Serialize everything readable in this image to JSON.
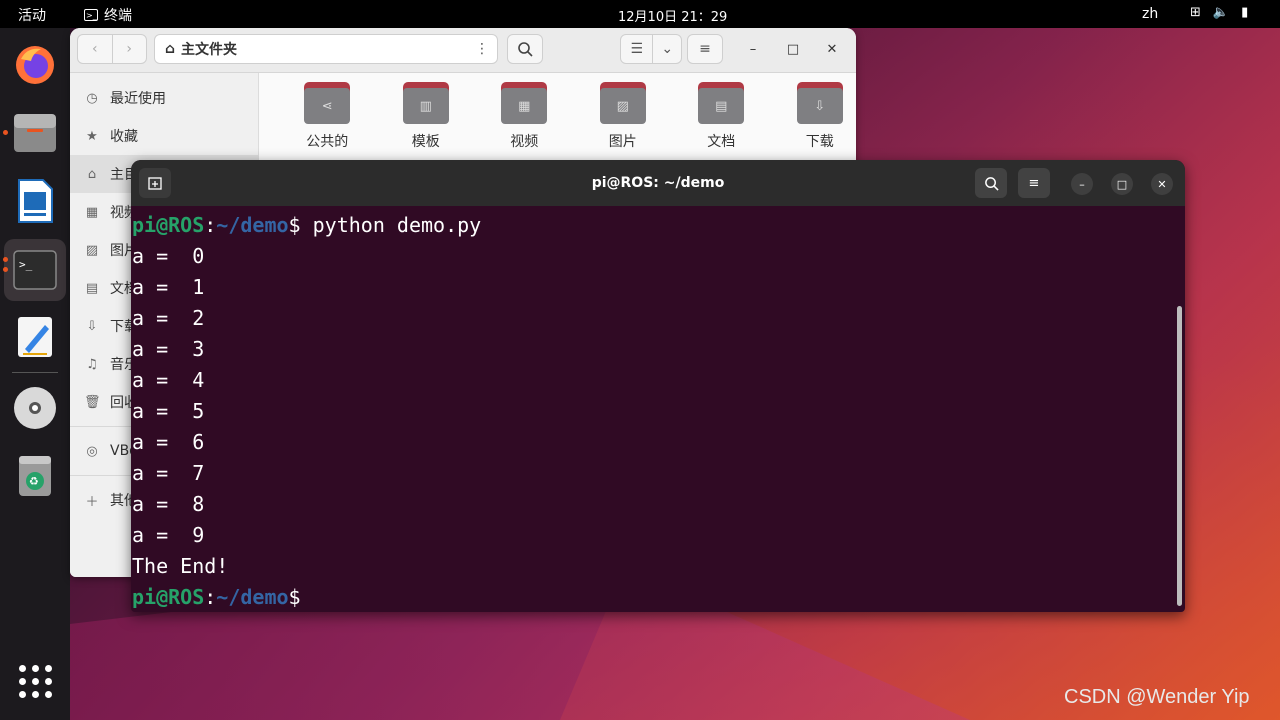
{
  "topbar": {
    "activities": "活动",
    "app_name": "终端",
    "clock": "12月10日  21：29",
    "lang": "zh",
    "tray_icons": [
      "network-icon",
      "volume-icon",
      "battery-icon"
    ]
  },
  "dock": {
    "items": [
      "firefox-icon",
      "files-icon",
      "writer-icon",
      "terminal-icon",
      "text-editor-icon",
      "disc-icon",
      "trash-icon"
    ],
    "show_apps": "apps-grid-icon"
  },
  "files": {
    "path": "主文件夹",
    "sidebar": [
      {
        "label": "最近使用",
        "icon": "clock-icon"
      },
      {
        "label": "收藏",
        "icon": "star-icon"
      },
      {
        "label": "主目",
        "icon": "home-icon"
      },
      {
        "label": "视频",
        "icon": "video-icon"
      },
      {
        "label": "图片",
        "icon": "picture-icon"
      },
      {
        "label": "文档",
        "icon": "document-icon"
      },
      {
        "label": "下载",
        "icon": "download-icon"
      },
      {
        "label": "音乐",
        "icon": "music-icon"
      },
      {
        "label": "回收",
        "icon": "trash-icon"
      },
      {
        "label": "VBo",
        "icon": "disc-icon"
      },
      {
        "label": "其他",
        "icon": "plus-icon"
      }
    ],
    "folders": [
      {
        "label": "公共的",
        "glyph": "⋖"
      },
      {
        "label": "模板",
        "glyph": "▥"
      },
      {
        "label": "视频",
        "glyph": "▦"
      },
      {
        "label": "图片",
        "glyph": "▨"
      },
      {
        "label": "文档",
        "glyph": "▤"
      },
      {
        "label": "下载",
        "glyph": "⇩"
      }
    ]
  },
  "terminal": {
    "title": "pi@ROS: ~/demo",
    "prompt_user": "pi@ROS",
    "prompt_sep": ":",
    "prompt_path": "~/demo",
    "prompt_sign": "$",
    "command": " python demo.py",
    "output": [
      "a =  0",
      "a =  1",
      "a =  2",
      "a =  3",
      "a =  4",
      "a =  5",
      "a =  6",
      "a =  7",
      "a =  8",
      "a =  9",
      "The End!"
    ]
  },
  "watermark": "CSDN @Wender Yip"
}
